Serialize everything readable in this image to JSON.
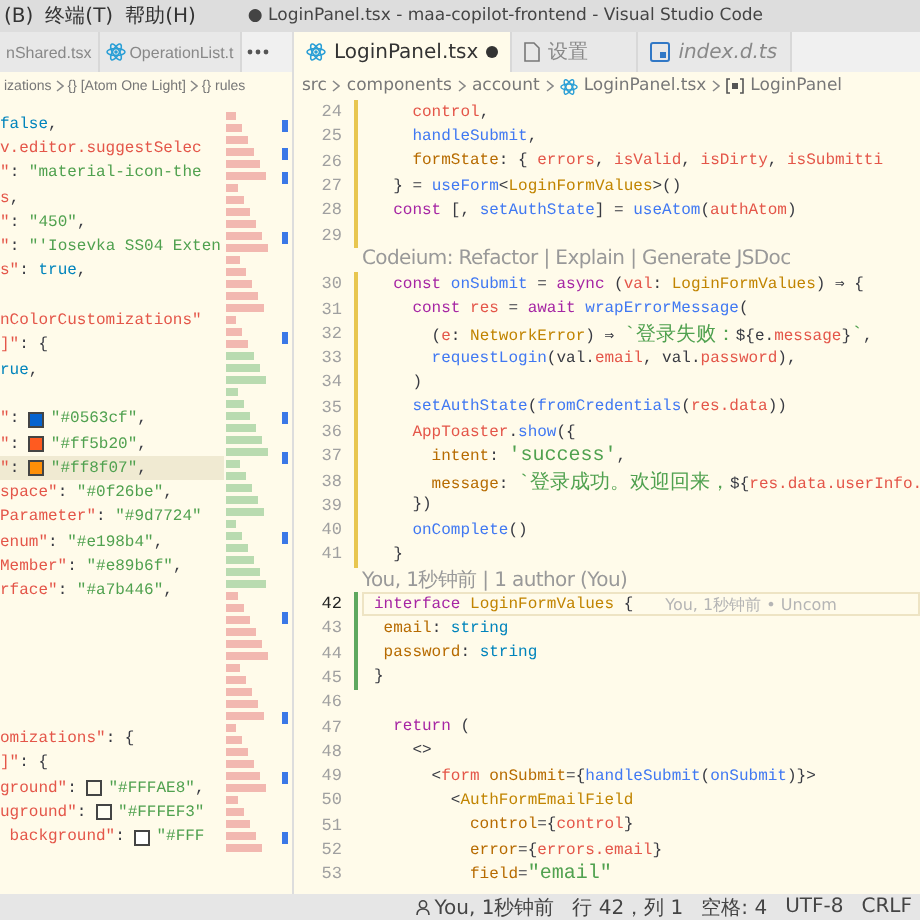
{
  "menu": [
    "(B)",
    "终端(T)",
    "帮助(H)"
  ],
  "window": {
    "title": "● LoginPanel.tsx - maa-copilot-frontend - Visual Studio Code"
  },
  "left_editor": {
    "tabs": [
      {
        "label": "nShared.tsx",
        "selected": false,
        "dirty": false,
        "preview": false
      },
      {
        "label": "OperationList.t",
        "selected": false,
        "dirty": false,
        "preview": false,
        "kind": "react"
      }
    ],
    "breadcrumb": [
      {
        "text": "izations"
      },
      {
        "text": "{} [Atom One Light]"
      },
      {
        "text": "{} rules"
      }
    ],
    "lines": [
      {
        "current": false,
        "tokens": [
          {
            "t": "false",
            "kind": "builtin"
          },
          {
            "t": ",",
            "kind": "p"
          }
        ]
      },
      {
        "current": false,
        "tokens": [
          {
            "t": "v.editor.suggestSelec",
            "kind": "var"
          }
        ]
      },
      {
        "current": false,
        "tokens": [
          {
            "t": "\"",
            "kind": "var"
          },
          {
            "t": ": ",
            "kind": "p"
          },
          {
            "t": "\"material-icon-the",
            "kind": "str"
          }
        ]
      },
      {
        "current": false,
        "tokens": [
          {
            "t": "s",
            "kind": "var"
          },
          {
            "t": ",",
            "kind": "p"
          }
        ]
      },
      {
        "current": false,
        "tokens": [
          {
            "t": "\"",
            "kind": "var"
          },
          {
            "t": ": ",
            "kind": "p"
          },
          {
            "t": "\"450\"",
            "kind": "str"
          },
          {
            "t": ",",
            "kind": "p"
          }
        ]
      },
      {
        "current": false,
        "tokens": [
          {
            "t": "\"",
            "kind": "var"
          },
          {
            "t": ": ",
            "kind": "p"
          },
          {
            "t": "\"'Iosevka SS04 Exten",
            "kind": "str"
          }
        ]
      },
      {
        "current": false,
        "tokens": [
          {
            "t": "s\"",
            "kind": "var"
          },
          {
            "t": ": ",
            "kind": "p"
          },
          {
            "t": "true",
            "kind": "builtin"
          },
          {
            "t": ",",
            "kind": "p"
          }
        ]
      },
      {
        "current": false
      },
      {
        "current": false,
        "tokens": [
          {
            "t": "nColorCustomizations\"",
            "kind": "var"
          }
        ]
      },
      {
        "current": false,
        "tokens": [
          {
            "t": "]\"",
            "kind": "var"
          },
          {
            "t": ": {",
            "kind": "p"
          }
        ]
      },
      {
        "current": false,
        "tokens": [
          {
            "t": "rue",
            "kind": "builtin"
          },
          {
            "t": ",",
            "kind": "p"
          }
        ]
      },
      {
        "current": false
      },
      {
        "current": false,
        "tokens": [
          {
            "t": "\"",
            "kind": "var"
          },
          {
            "t": ": ",
            "kind": "p"
          },
          {
            "kind": "swatch",
            "color": "#0563cf"
          },
          {
            "t": "\"#0563cf\"",
            "kind": "str"
          },
          {
            "t": ",",
            "kind": "p"
          }
        ]
      },
      {
        "current": false,
        "tokens": [
          {
            "t": "\"",
            "kind": "var"
          },
          {
            "t": ": ",
            "kind": "p"
          },
          {
            "kind": "swatch",
            "color": "#ff5b20"
          },
          {
            "t": "\"#ff5b20\"",
            "kind": "str"
          },
          {
            "t": ",",
            "kind": "p"
          }
        ]
      },
      {
        "current": true,
        "tokens": [
          {
            "t": "\"",
            "kind": "var"
          },
          {
            "t": ": ",
            "kind": "p"
          },
          {
            "kind": "swatch",
            "color": "#ff8f07"
          },
          {
            "t": "\"#ff8f07\"",
            "kind": "str"
          },
          {
            "t": ",",
            "kind": "p"
          }
        ]
      },
      {
        "current": false,
        "tokens": [
          {
            "t": "space\"",
            "kind": "var"
          },
          {
            "t": ": ",
            "kind": "p"
          },
          {
            "t": "\"#0f26be\"",
            "kind": "str"
          },
          {
            "t": ",",
            "kind": "p"
          }
        ]
      },
      {
        "current": false,
        "tokens": [
          {
            "t": "Parameter\"",
            "kind": "var"
          },
          {
            "t": ": ",
            "kind": "p"
          },
          {
            "t": "\"#9d7724\"",
            "kind": "str"
          }
        ]
      },
      {
        "current": false,
        "tokens": [
          {
            "t": "enum\"",
            "kind": "var"
          },
          {
            "t": ": ",
            "kind": "p"
          },
          {
            "t": "\"#e198b4\"",
            "kind": "str"
          },
          {
            "t": ",",
            "kind": "p"
          }
        ]
      },
      {
        "current": false,
        "tokens": [
          {
            "t": "Member\"",
            "kind": "var"
          },
          {
            "t": ": ",
            "kind": "p"
          },
          {
            "t": "\"#e89b6f\"",
            "kind": "str"
          },
          {
            "t": ",",
            "kind": "p"
          }
        ]
      },
      {
        "current": false,
        "tokens": [
          {
            "t": "rface\"",
            "kind": "var"
          },
          {
            "t": ": ",
            "kind": "p"
          },
          {
            "t": "\"#a7b446\"",
            "kind": "str"
          },
          {
            "t": ",",
            "kind": "p"
          }
        ]
      },
      {
        "current": false
      },
      {
        "current": false
      },
      {
        "current": false
      },
      {
        "current": false
      },
      {
        "current": false
      },
      {
        "current": false,
        "tokens": [
          {
            "t": "omizations\"",
            "kind": "var"
          },
          {
            "t": ": {",
            "kind": "p"
          }
        ]
      },
      {
        "current": false,
        "tokens": [
          {
            "t": "]\"",
            "kind": "var"
          },
          {
            "t": ": {",
            "kind": "p"
          }
        ]
      },
      {
        "current": false,
        "tokens": [
          {
            "t": "ground\"",
            "kind": "var"
          },
          {
            "t": ": ",
            "kind": "p"
          },
          {
            "kind": "swatch",
            "color": "#fffae8"
          },
          {
            "t": "\"#FFFAE8\"",
            "kind": "str"
          },
          {
            "t": ",",
            "kind": "p"
          }
        ]
      },
      {
        "current": false,
        "tokens": [
          {
            "t": "uground\"",
            "kind": "var"
          },
          {
            "t": ": ",
            "kind": "p"
          },
          {
            "kind": "swatch",
            "color": "#fffef3"
          },
          {
            "t": "\"#FFFEF3\"",
            "kind": "str"
          }
        ]
      },
      {
        "current": false,
        "tokens": [
          {
            "t": " background\"",
            "kind": "var"
          },
          {
            "t": ": ",
            "kind": "p"
          },
          {
            "kind": "swatch",
            "color": "#ffffff"
          },
          {
            "t": "\"#FFF",
            "kind": "str"
          }
        ]
      }
    ]
  },
  "right_editor": {
    "tabs": [
      {
        "label": "LoginPanel.tsx",
        "selected": true,
        "dirty": true,
        "preview": false,
        "kind": "react"
      },
      {
        "label": "设置",
        "selected": false,
        "dirty": false,
        "preview": false,
        "kind": "file"
      },
      {
        "label": "index.d.ts",
        "selected": false,
        "dirty": false,
        "preview": true,
        "kind": "ts"
      }
    ],
    "breadcrumb": [
      {
        "text": "src"
      },
      {
        "text": "components"
      },
      {
        "text": "account"
      },
      {
        "text": "LoginPanel.tsx",
        "kind": "react"
      },
      {
        "text": "LoginPanel",
        "kind": "symbol"
      }
    ],
    "lines": [
      {
        "kind": "code",
        "n": "24",
        "current": false,
        "modified": true,
        "added": false,
        "tokens": [
          {
            "t": "    control",
            "kind": "var"
          },
          {
            "t": ",",
            "kind": "p"
          }
        ]
      },
      {
        "kind": "code",
        "n": "25",
        "current": false,
        "modified": true,
        "added": false,
        "tokens": [
          {
            "t": "    handleSubmit",
            "kind": "fn"
          },
          {
            "t": ",",
            "kind": "p"
          }
        ]
      },
      {
        "kind": "code",
        "n": "26",
        "current": false,
        "modified": true,
        "added": false,
        "tokens": [
          {
            "t": "    formState",
            "kind": "prop"
          },
          {
            "t": ": { ",
            "kind": "p"
          },
          {
            "t": "errors",
            "kind": "var"
          },
          {
            "t": ", ",
            "kind": "p"
          },
          {
            "t": "isValid",
            "kind": "var"
          },
          {
            "t": ", ",
            "kind": "p"
          },
          {
            "t": "isDirty",
            "kind": "var"
          },
          {
            "t": ", ",
            "kind": "p"
          },
          {
            "t": "isSubmitti",
            "kind": "var"
          }
        ]
      },
      {
        "kind": "code",
        "n": "27",
        "current": false,
        "modified": true,
        "added": false,
        "tokens": [
          {
            "t": "  } = ",
            "kind": "p"
          },
          {
            "t": "useForm",
            "kind": "fn"
          },
          {
            "t": "<",
            "kind": "p"
          },
          {
            "t": "LoginFormValues",
            "kind": "type"
          },
          {
            "t": ">()",
            "kind": "p"
          }
        ]
      },
      {
        "kind": "code",
        "n": "28",
        "current": false,
        "modified": true,
        "added": false,
        "tokens": [
          {
            "t": "  const",
            "kind": "kw"
          },
          {
            "t": " [, ",
            "kind": "p"
          },
          {
            "t": "setAuthState",
            "kind": "fn"
          },
          {
            "t": "] = ",
            "kind": "p"
          },
          {
            "t": "useAtom",
            "kind": "fn"
          },
          {
            "t": "(",
            "kind": "p"
          },
          {
            "t": "authAtom",
            "kind": "var"
          },
          {
            "t": ")",
            "kind": "p"
          }
        ]
      },
      {
        "kind": "code",
        "n": "29",
        "current": false,
        "modified": true,
        "added": false
      },
      {
        "kind": "lens",
        "text": "Codeium: Refactor | Explain | Generate JSDoc"
      },
      {
        "kind": "code",
        "n": "30",
        "current": false,
        "modified": true,
        "added": false,
        "tokens": [
          {
            "t": "  const",
            "kind": "kw"
          },
          {
            "t": " onSubmit",
            "kind": "fn"
          },
          {
            "t": " = ",
            "kind": "p"
          },
          {
            "t": "async",
            "kind": "kw"
          },
          {
            "t": " (",
            "kind": "p"
          },
          {
            "t": "val",
            "kind": "var"
          },
          {
            "t": ": ",
            "kind": "p"
          },
          {
            "t": "LoginFormValues",
            "kind": "type"
          },
          {
            "t": ") ⇒ {",
            "kind": "p"
          }
        ]
      },
      {
        "kind": "code",
        "n": "31",
        "current": false,
        "modified": true,
        "added": false,
        "tokens": [
          {
            "t": "    const",
            "kind": "kw"
          },
          {
            "t": " res",
            "kind": "var"
          },
          {
            "t": " = ",
            "kind": "p"
          },
          {
            "t": "await",
            "kind": "kw"
          },
          {
            "t": " wrapErrorMessage",
            "kind": "fn"
          },
          {
            "t": "(",
            "kind": "p"
          }
        ]
      },
      {
        "kind": "code",
        "n": "32",
        "current": false,
        "modified": true,
        "added": false,
        "tokens": [
          {
            "t": "      (",
            "kind": "p"
          },
          {
            "t": "e",
            "kind": "var"
          },
          {
            "t": ": ",
            "kind": "p"
          },
          {
            "t": "NetworkError",
            "kind": "type"
          },
          {
            "t": ") ⇒ ",
            "kind": "p"
          },
          {
            "t": "`登录失败：",
            "kind": "str"
          },
          {
            "t": "${e.",
            "kind": "p"
          },
          {
            "t": "message",
            "kind": "var"
          },
          {
            "t": "}",
            "kind": "p"
          },
          {
            "t": "`",
            "kind": "str"
          },
          {
            "t": ",",
            "kind": "p"
          }
        ]
      },
      {
        "kind": "code",
        "n": "33",
        "current": false,
        "modified": true,
        "added": false,
        "tokens": [
          {
            "t": "      requestLogin",
            "kind": "fn"
          },
          {
            "t": "(val.",
            "kind": "p"
          },
          {
            "t": "email",
            "kind": "var"
          },
          {
            "t": ", val.",
            "kind": "p"
          },
          {
            "t": "password",
            "kind": "var"
          },
          {
            "t": "),",
            "kind": "p"
          }
        ]
      },
      {
        "kind": "code",
        "n": "34",
        "current": false,
        "modified": true,
        "added": false,
        "tokens": [
          {
            "t": "    )",
            "kind": "p"
          }
        ]
      },
      {
        "kind": "code",
        "n": "35",
        "current": false,
        "modified": true,
        "added": false,
        "tokens": [
          {
            "t": "    setAuthState",
            "kind": "fn"
          },
          {
            "t": "(",
            "kind": "p"
          },
          {
            "t": "fromCredentials",
            "kind": "fn"
          },
          {
            "t": "(",
            "kind": "p"
          },
          {
            "t": "res.data",
            "kind": "var"
          },
          {
            "t": "))",
            "kind": "p"
          }
        ]
      },
      {
        "kind": "code",
        "n": "36",
        "current": false,
        "modified": true,
        "added": false,
        "tokens": [
          {
            "t": "    AppToaster",
            "kind": "var"
          },
          {
            "t": ".",
            "kind": "p"
          },
          {
            "t": "show",
            "kind": "fn"
          },
          {
            "t": "({",
            "kind": "p"
          }
        ]
      },
      {
        "kind": "code",
        "n": "37",
        "current": false,
        "modified": true,
        "added": false,
        "tokens": [
          {
            "t": "      intent",
            "kind": "prop"
          },
          {
            "t": ": ",
            "kind": "p"
          },
          {
            "t": "'success'",
            "kind": "str"
          },
          {
            "t": ",",
            "kind": "p"
          }
        ]
      },
      {
        "kind": "code",
        "n": "38",
        "current": false,
        "modified": true,
        "added": false,
        "tokens": [
          {
            "t": "      message",
            "kind": "prop"
          },
          {
            "t": ": ",
            "kind": "p"
          },
          {
            "t": "`登录成功。欢迎回来，",
            "kind": "str"
          },
          {
            "t": "${",
            "kind": "p"
          },
          {
            "t": "res.data.userInfo.",
            "kind": "var"
          }
        ]
      },
      {
        "kind": "code",
        "n": "39",
        "current": false,
        "modified": true,
        "added": false,
        "tokens": [
          {
            "t": "    })",
            "kind": "p"
          }
        ]
      },
      {
        "kind": "code",
        "n": "40",
        "current": false,
        "modified": true,
        "added": false,
        "tokens": [
          {
            "t": "    onComplete",
            "kind": "fn"
          },
          {
            "t": "()",
            "kind": "p"
          }
        ]
      },
      {
        "kind": "code",
        "n": "41",
        "current": false,
        "modified": true,
        "added": false,
        "tokens": [
          {
            "t": "  }",
            "kind": "p"
          }
        ]
      },
      {
        "kind": "lens",
        "text": "You, 1秒钟前 | 1 author (You)"
      },
      {
        "kind": "code",
        "n": "42",
        "current": true,
        "modified": false,
        "added": true,
        "blame": "You, 1秒钟前 • Uncom",
        "tokens": [
          {
            "t": "interface",
            "kind": "kw"
          },
          {
            "t": " LoginFormValues",
            "kind": "type"
          },
          {
            "t": " {",
            "kind": "p"
          }
        ]
      },
      {
        "kind": "code",
        "n": "43",
        "current": false,
        "modified": false,
        "added": true,
        "tokens": [
          {
            "t": " email",
            "kind": "prop"
          },
          {
            "t": ": ",
            "kind": "p"
          },
          {
            "t": "string",
            "kind": "builtin"
          }
        ]
      },
      {
        "kind": "code",
        "n": "44",
        "current": false,
        "modified": false,
        "added": true,
        "tokens": [
          {
            "t": " password",
            "kind": "prop"
          },
          {
            "t": ": ",
            "kind": "p"
          },
          {
            "t": "string",
            "kind": "builtin"
          }
        ]
      },
      {
        "kind": "code",
        "n": "45",
        "current": false,
        "modified": false,
        "added": true,
        "tokens": [
          {
            "t": "}",
            "kind": "p"
          }
        ]
      },
      {
        "kind": "code",
        "n": "46",
        "current": false,
        "modified": false,
        "added": false
      },
      {
        "kind": "code",
        "n": "47",
        "current": false,
        "modified": false,
        "added": false,
        "tokens": [
          {
            "t": "  return",
            "kind": "kw"
          },
          {
            "t": " (",
            "kind": "p"
          }
        ]
      },
      {
        "kind": "code",
        "n": "48",
        "current": false,
        "modified": false,
        "added": false,
        "tokens": [
          {
            "t": "    <>",
            "kind": "p"
          }
        ]
      },
      {
        "kind": "code",
        "n": "49",
        "current": false,
        "modified": false,
        "added": false,
        "tokens": [
          {
            "t": "      <",
            "kind": "p"
          },
          {
            "t": "form",
            "kind": "var"
          },
          {
            "t": " onSubmit",
            "kind": "prop"
          },
          {
            "t": "={",
            "kind": "p"
          },
          {
            "t": "handleSubmit",
            "kind": "fn"
          },
          {
            "t": "(",
            "kind": "p"
          },
          {
            "t": "onSubmit",
            "kind": "fn"
          },
          {
            "t": ")}>",
            "kind": "p"
          }
        ]
      },
      {
        "kind": "code",
        "n": "50",
        "current": false,
        "modified": false,
        "added": false,
        "tokens": [
          {
            "t": "        <",
            "kind": "p"
          },
          {
            "t": "AuthFormEmailField",
            "kind": "type"
          }
        ]
      },
      {
        "kind": "code",
        "n": "51",
        "current": false,
        "modified": false,
        "added": false,
        "tokens": [
          {
            "t": "          control",
            "kind": "prop"
          },
          {
            "t": "={",
            "kind": "p"
          },
          {
            "t": "control",
            "kind": "var"
          },
          {
            "t": "}",
            "kind": "p"
          }
        ]
      },
      {
        "kind": "code",
        "n": "52",
        "current": false,
        "modified": false,
        "added": false,
        "tokens": [
          {
            "t": "          error",
            "kind": "prop"
          },
          {
            "t": "={",
            "kind": "p"
          },
          {
            "t": "errors.email",
            "kind": "var"
          },
          {
            "t": "}",
            "kind": "p"
          }
        ]
      },
      {
        "kind": "code",
        "n": "53",
        "current": false,
        "modified": false,
        "added": false,
        "tokens": [
          {
            "t": "          field",
            "kind": "prop"
          },
          {
            "t": "=",
            "kind": "p"
          },
          {
            "t": "\"email\"",
            "kind": "str"
          }
        ]
      }
    ]
  },
  "status_bar": {
    "blame": "You, 1秒钟前",
    "position": "行 42，列 1",
    "indent": "空格: 4",
    "encoding": "UTF-8",
    "eol": "CRLF"
  }
}
